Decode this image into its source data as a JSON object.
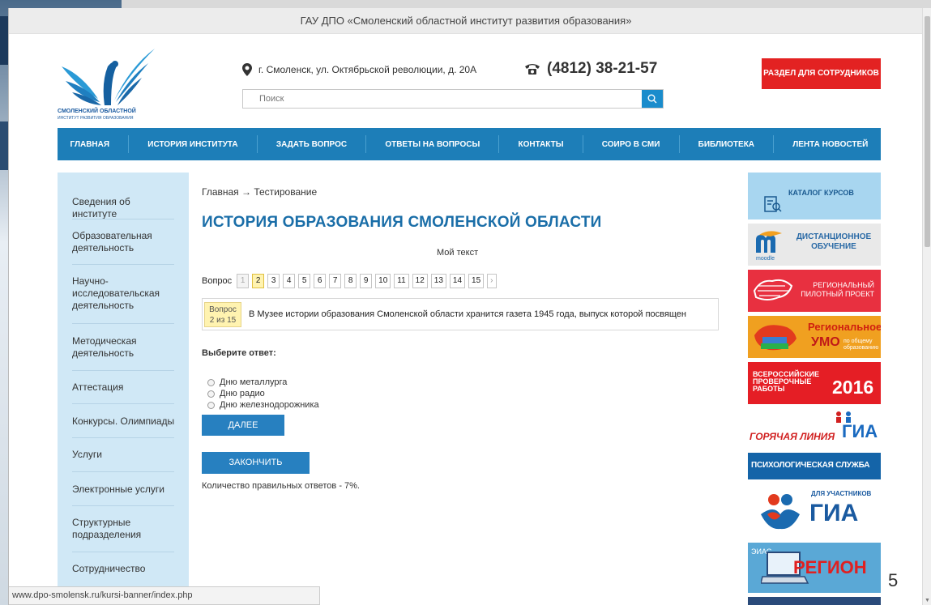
{
  "topbar": {
    "title": "ГАУ ДПО «Смоленский областной институт развития образования»"
  },
  "logo": {
    "line1": "СМОЛЕНСКИЙ ОБЛАСТНОЙ",
    "line2": "ИНСТИТУТ РАЗВИТИЯ ОБРАЗОВАНИЯ"
  },
  "header": {
    "address": "г. Смоленск, ул. Октябрьской революции, д. 20А",
    "phone": "(4812) 38-21-57",
    "staff_button": "РАЗДЕЛ ДЛЯ СОТРУДНИКОВ",
    "search_placeholder": "Поиск"
  },
  "nav": {
    "items": [
      {
        "label": "ГЛАВНАЯ"
      },
      {
        "label": "ИСТОРИЯ ИНСТИТУТА"
      },
      {
        "label": "ЗАДАТЬ ВОПРОС"
      },
      {
        "label": "ОТВЕТЫ НА ВОПРОСЫ"
      },
      {
        "label": "КОНТАКТЫ"
      },
      {
        "label": "СОИРО В СМИ"
      },
      {
        "label": "БИБЛИОТЕКА"
      },
      {
        "label": "ЛЕНТА НОВОСТЕЙ"
      }
    ]
  },
  "sidebar": {
    "items": [
      {
        "label": "Сведения об институте"
      },
      {
        "label": "Образовательная деятельность"
      },
      {
        "label": "Научно-исследовательская деятельность"
      },
      {
        "label": "Методическая деятельность"
      },
      {
        "label": "Аттестация"
      },
      {
        "label": "Конкурсы. Олимпиады"
      },
      {
        "label": "Услуги"
      },
      {
        "label": "Электронные услуги"
      },
      {
        "label": "Структурные подразделения"
      },
      {
        "label": "Сотрудничество"
      }
    ]
  },
  "main": {
    "breadcrumb": "Главная → Тестирование",
    "title": "ИСТОРИЯ ОБРАЗОВАНИЯ СМОЛЕНСКОЙ ОБЛАСТИ",
    "subtitle": "Мой текст",
    "question_nav_label": "Вопрос",
    "question_numbers": [
      "1",
      "2",
      "3",
      "4",
      "5",
      "6",
      "7",
      "8",
      "9",
      "10",
      "11",
      "12",
      "13",
      "14",
      "15"
    ],
    "current_question": 2,
    "next_arrow": "›",
    "question_label": "Вопрос",
    "question_counter": "2 из 15",
    "question_text": "В Музее истории образования Смоленской области хранится газета 1945 года, выпуск которой посвящен",
    "choose_label": "Выберите ответ:",
    "options": [
      {
        "label": "Дню металлурга"
      },
      {
        "label": "Дню радио"
      },
      {
        "label": "Дню железнодорожника"
      }
    ],
    "next_button": "ДАЛЕЕ",
    "finish_button": "ЗАКОНЧИТЬ",
    "result_text": "Количество правильных ответов - 7%."
  },
  "banners": {
    "catalog": "КАТАЛОГ КУРСОВ",
    "distance": "ДИСТАНЦИОННОЕ ОБУЧЕНИЕ",
    "moodle": "moodle",
    "pilot": "РЕГИОНАЛЬНЫЙ ПИЛОТНЫЙ ПРОЕКТ",
    "umo1": "Региональное",
    "umo2": "УМО",
    "umo3": "по общему образованию",
    "vpr": "ВСЕРОССИЙСКИЕ ПРОВЕРОЧНЫЕ РАБОТЫ",
    "vpr_year": "2016",
    "hotline": "ГОРЯЧАЯ ЛИНИЯ",
    "hotline_gia": "ГИА",
    "psych": "ПСИХОЛОГИЧЕСКАЯ СЛУЖБА",
    "gia_for": "ДЛЯ УЧАСТНИКОВ",
    "gia": "ГИА",
    "eias": "ЭИАС",
    "region": "РЕГИОН"
  },
  "colors": {
    "accent": "#1d7eb8",
    "sidebar": "#d0e8f6",
    "staff": "#e32222",
    "button": "#2780c0"
  },
  "statusbar": {
    "url": "www.dpo-smolensk.ru/kursi-banner/index.php"
  },
  "slide_number": "5"
}
